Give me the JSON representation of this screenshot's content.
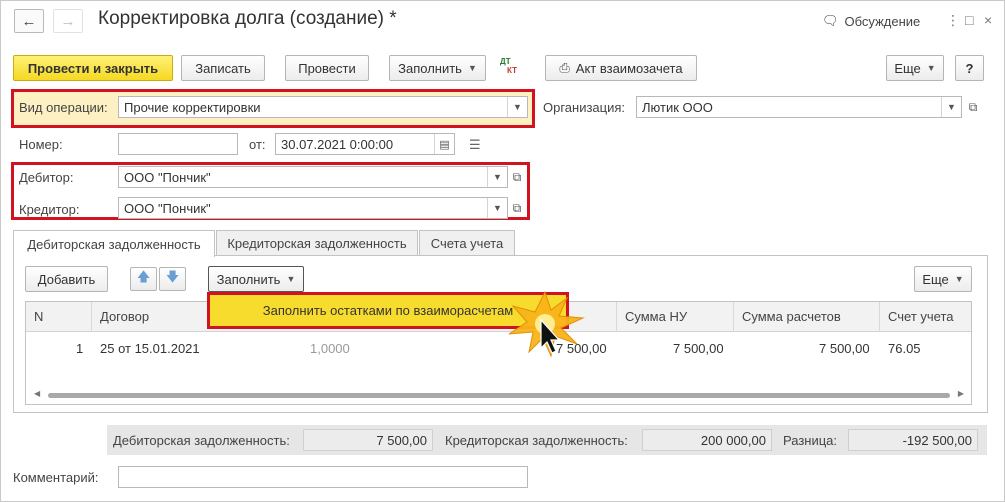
{
  "window": {
    "title": "Корректировка долга (создание) *",
    "discussion_label": "Обсуждение"
  },
  "toolbar": {
    "post_close": "Провести и закрыть",
    "save": "Записать",
    "post": "Провести",
    "fill": "Заполнить",
    "dtkt_top": "ДТ",
    "dtkt_bottom": "КТ",
    "act": "Акт взаимозачета",
    "more": "Еще",
    "help": "?"
  },
  "form": {
    "operation_label": "Вид операции:",
    "operation_value": "Прочие корректировки",
    "org_label": "Организация:",
    "org_value": "Лютик ООО",
    "number_label": "Номер:",
    "number_value": "",
    "date_label": "от:",
    "date_value": "30.07.2021  0:00:00",
    "debtor_label": "Дебитор:",
    "debtor_value": "ООО \"Пончик\"",
    "creditor_label": "Кредитор:",
    "creditor_value": "ООО \"Пончик\"",
    "comment_label": "Комментарий:",
    "comment_value": ""
  },
  "tabs": [
    {
      "label": "Дебиторская задолженность",
      "active": true
    },
    {
      "label": "Кредиторская задолженность",
      "active": false
    },
    {
      "label": "Счета учета",
      "active": false
    }
  ],
  "table_toolbar": {
    "add": "Добавить",
    "fill": "Заполнить",
    "more": "Еще"
  },
  "fill_menu": {
    "item": "Заполнить остатками по взаиморасчетам"
  },
  "table": {
    "columns": [
      "N",
      "Договор",
      "Сумма НУ",
      "Сумма расчетов",
      "Счет учета"
    ],
    "rows": [
      {
        "n": "1",
        "contract": "25 от 15.01.2021",
        "rate": "1,0000",
        "amount": "7 500,00",
        "amount_nu": "7 500,00",
        "amount_settl": "7 500,00",
        "account": "76.05"
      }
    ]
  },
  "footer": {
    "receivable_label": "Дебиторская задолженность:",
    "receivable_value": "7 500,00",
    "payable_label": "Кредиторская задолженность:",
    "payable_value": "200 000,00",
    "diff_label": "Разница:",
    "diff_value": "-192 500,00"
  },
  "colors": {
    "primary_button": "#f5d922",
    "highlight_frame": "#d0131f"
  }
}
